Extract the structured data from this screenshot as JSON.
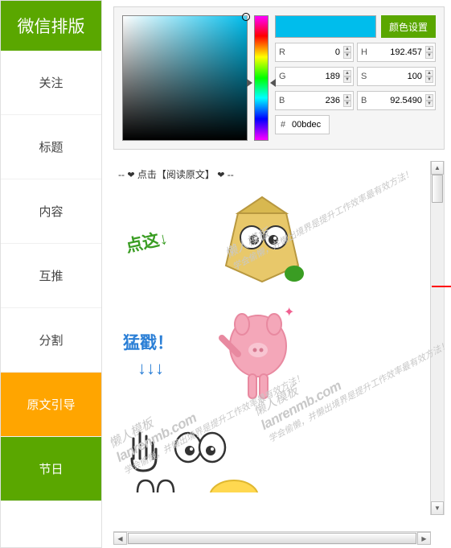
{
  "sidebar": {
    "title": "微信排版",
    "items": [
      {
        "label": "关注"
      },
      {
        "label": "标题"
      },
      {
        "label": "内容"
      },
      {
        "label": "互推"
      },
      {
        "label": "分割"
      },
      {
        "label": "原文引导"
      },
      {
        "label": "节日"
      }
    ]
  },
  "colorPicker": {
    "buttonLabel": "颜色设置",
    "swatch": "#00bdec",
    "r": {
      "label": "R",
      "value": "0"
    },
    "g": {
      "label": "G",
      "value": "189"
    },
    "b": {
      "label": "B",
      "value": "236"
    },
    "h": {
      "label": "H",
      "value": "192.457"
    },
    "s": {
      "label": "S",
      "value": "100"
    },
    "br": {
      "label": "B",
      "value": "92.5490"
    },
    "hexLabel": "#",
    "hex": "00bdec"
  },
  "content": {
    "promptPrefix": "-- ",
    "heart": "❤",
    "promptText": " 点击【阅读原文】 ",
    "promptSuffix": " --",
    "annotation1": "点这↓",
    "annotation2": "猛戳！",
    "arrows": "↓↓↓"
  },
  "watermark": {
    "main": "懒人模板",
    "url": "lanrenmb.com",
    "sub": "学会偷懒，并懒出境界是提升工作效率最有效方法！"
  }
}
